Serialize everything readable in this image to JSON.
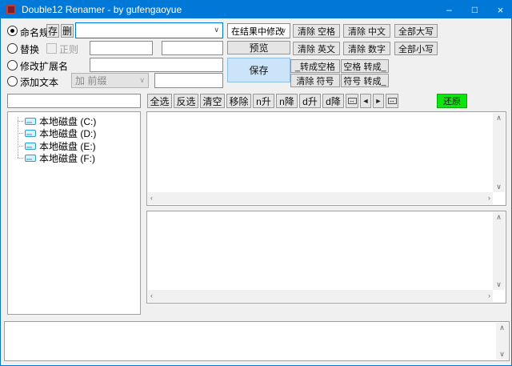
{
  "window": {
    "title": "Double12 Renamer - by gufengaoyue",
    "minimize_glyph": "–",
    "maximize_glyph": "□",
    "close_glyph": "×"
  },
  "rules": {
    "naming_label": "命名规则",
    "store_btn": "存",
    "delete_btn": "删",
    "naming_combo_value": "",
    "replace_label": "替换",
    "regex_label": "正则",
    "replace_find_value": "",
    "replace_with_value": "",
    "ext_label": "修改扩展名",
    "ext_value": "",
    "addtext_label": "添加文本",
    "addtext_mode": "加 前缀",
    "addtext_value": ""
  },
  "mid": {
    "scope_combo": "在结果中修改",
    "preview": "预览",
    "save": "保存"
  },
  "quick": {
    "clear_space": "清除 空格",
    "clear_chinese": "清除 中文",
    "upper_all": "全部大写",
    "clear_english": "清除 英文",
    "clear_digit": "清除 数字",
    "lower_all": "全部小写",
    "us_to_space": "_转成空格",
    "space_to_us": "空格 转成_",
    "clear_symbol": "清除 符号",
    "symbol_to_us": "符号 转成_"
  },
  "toolbar": {
    "select_all": "全选",
    "invert": "反选",
    "clear": "清空",
    "remove": "移除",
    "n_asc": "n升",
    "n_desc": "n降",
    "d_asc": "d升",
    "d_desc": "d降",
    "swap_glyph": "↔",
    "prev_glyph": "◄",
    "next_glyph": "►",
    "restore": "还原"
  },
  "tree": {
    "filter_value": "",
    "items": [
      {
        "label": "本地磁盘 (C:)"
      },
      {
        "label": "本地磁盘 (D:)"
      },
      {
        "label": "本地磁盘 (E:)"
      },
      {
        "label": "本地磁盘 (F:)"
      }
    ]
  },
  "icons": {
    "combo_chevron": "∨",
    "scroll_up": "∧",
    "scroll_down": "∨",
    "scroll_left": "‹",
    "scroll_right": "›"
  },
  "colors": {
    "titlebar": "#0078d7",
    "save_bg": "#cce4f7",
    "restore_bg": "#0ce60c"
  }
}
